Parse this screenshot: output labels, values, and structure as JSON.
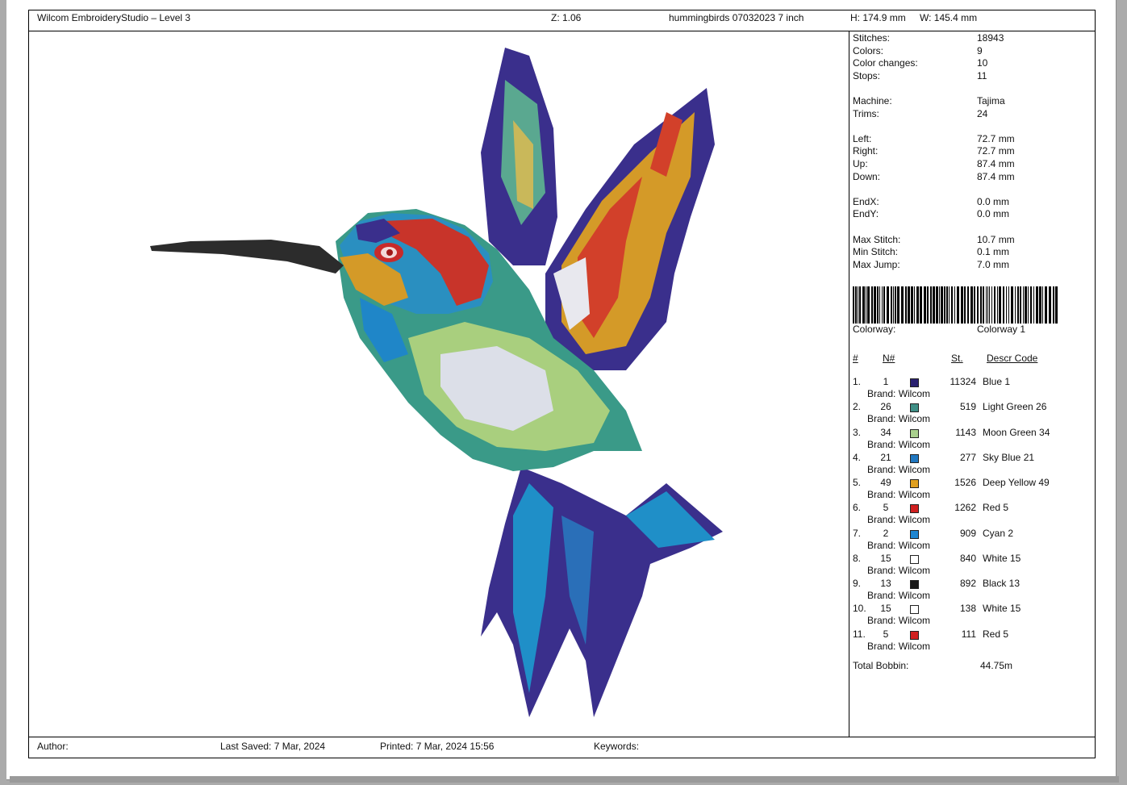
{
  "header": {
    "app_title": "Wilcom EmbroideryStudio – Level 3",
    "zoom": "Z: 1.06",
    "design_name": "hummingbirds 07032023 7 inch",
    "height": "H: 174.9 mm",
    "width": "W: 145.4 mm"
  },
  "stats": [
    {
      "label": "Stitches:",
      "value": "18943"
    },
    {
      "label": "Colors:",
      "value": "9"
    },
    {
      "label": "Color changes:",
      "value": "10"
    },
    {
      "label": "Stops:",
      "value": "11"
    },
    {
      "label": "Machine:",
      "value": "Tajima"
    },
    {
      "label": "Trims:",
      "value": "24"
    },
    {
      "label": "Left:",
      "value": "72.7 mm"
    },
    {
      "label": "Right:",
      "value": "72.7 mm"
    },
    {
      "label": "Up:",
      "value": "87.4 mm"
    },
    {
      "label": "Down:",
      "value": "87.4 mm"
    },
    {
      "label": "EndX:",
      "value": "0.0 mm"
    },
    {
      "label": "EndY:",
      "value": "0.0 mm"
    },
    {
      "label": "Max Stitch:",
      "value": "10.7 mm"
    },
    {
      "label": "Min Stitch:",
      "value": "0.1 mm"
    },
    {
      "label": "Max Jump:",
      "value": "7.0 mm"
    }
  ],
  "colorway": {
    "label": "Colorway:",
    "value": "Colorway 1"
  },
  "table_headers": {
    "num": "#",
    "needle": "N#",
    "stitches": "St.",
    "descr": "Descr  Code"
  },
  "colors": [
    {
      "idx": "1.",
      "needle": "1",
      "hex": "#2a2170",
      "stitches": "11324",
      "descr": "Blue 1",
      "brand": "Brand: Wilcom"
    },
    {
      "idx": "2.",
      "needle": "26",
      "hex": "#3f8f86",
      "stitches": "519",
      "descr": "Light Green 26",
      "brand": "Brand: Wilcom"
    },
    {
      "idx": "3.",
      "needle": "34",
      "hex": "#a9d08e",
      "stitches": "1143",
      "descr": "Moon Green 34",
      "brand": "Brand: Wilcom"
    },
    {
      "idx": "4.",
      "needle": "21",
      "hex": "#2077c0",
      "stitches": "277",
      "descr": "Sky Blue 21",
      "brand": "Brand: Wilcom"
    },
    {
      "idx": "5.",
      "needle": "49",
      "hex": "#e0a020",
      "stitches": "1526",
      "descr": "Deep Yellow 49",
      "brand": "Brand: Wilcom"
    },
    {
      "idx": "6.",
      "needle": "5",
      "hex": "#d02020",
      "stitches": "1262",
      "descr": "Red 5",
      "brand": "Brand: Wilcom"
    },
    {
      "idx": "7.",
      "needle": "2",
      "hex": "#1f86d0",
      "stitches": "909",
      "descr": "Cyan 2",
      "brand": "Brand: Wilcom"
    },
    {
      "idx": "8.",
      "needle": "15",
      "hex": "#ffffff",
      "stitches": "840",
      "descr": "White 15",
      "brand": "Brand: Wilcom"
    },
    {
      "idx": "9.",
      "needle": "13",
      "hex": "#1a1a1a",
      "stitches": "892",
      "descr": "Black 13",
      "brand": "Brand: Wilcom"
    },
    {
      "idx": "10.",
      "needle": "15",
      "hex": "#ffffff",
      "stitches": "138",
      "descr": "White 15",
      "brand": "Brand: Wilcom"
    },
    {
      "idx": "11.",
      "needle": "5",
      "hex": "#d02020",
      "stitches": "111",
      "descr": "Red 5",
      "brand": "Brand: Wilcom"
    }
  ],
  "total_bobbin": {
    "label": "Total Bobbin:",
    "value": "44.75m"
  },
  "footer": {
    "author_label": "Author:",
    "last_saved": "Last Saved:  7 Mar, 2024",
    "printed": "Printed:  7 Mar, 2024 15:56",
    "keywords_label": "Keywords:"
  }
}
